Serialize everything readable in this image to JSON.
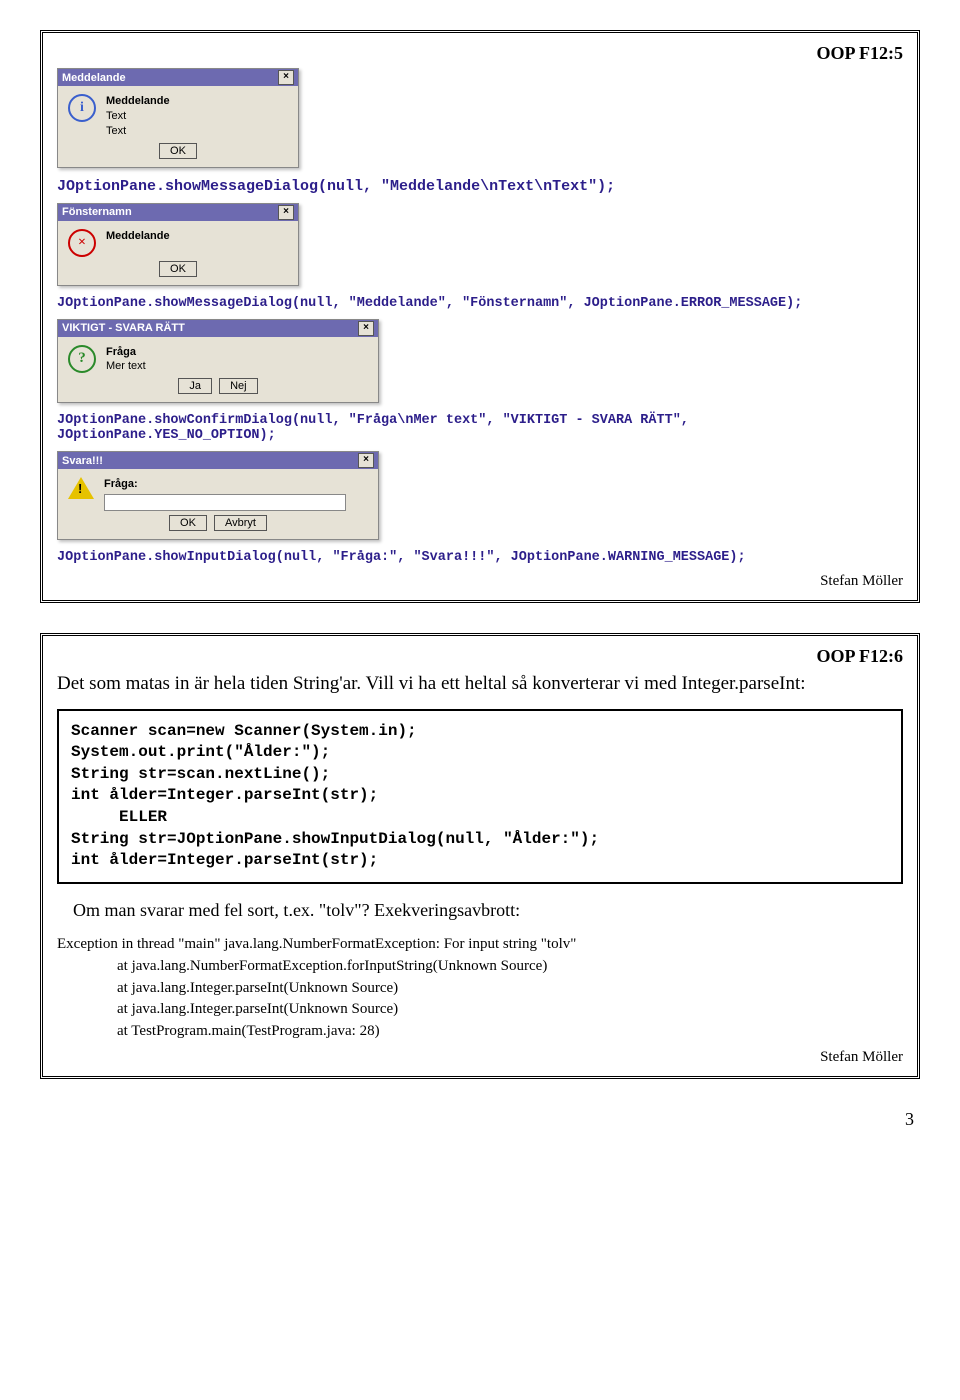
{
  "slide5": {
    "header": "OOP F12:5",
    "dialog1": {
      "title": "Meddelande",
      "lines": [
        "Meddelande",
        "Text",
        "Text"
      ],
      "ok": "OK"
    },
    "code1": "JOptionPane.showMessageDialog(null, \"Meddelande\\nText\\nText\");",
    "dialog2": {
      "title": "Fönsternamn",
      "line": "Meddelande",
      "ok": "OK"
    },
    "code2": "JOptionPane.showMessageDialog(null, \"Meddelande\", \"Fönsternamn\", JOptionPane.ERROR_MESSAGE);",
    "dialog3": {
      "title": "VIKTIGT - SVARA RÄTT",
      "lines": [
        "Fråga",
        "Mer text"
      ],
      "yes": "Ja",
      "no": "Nej"
    },
    "code3": "JOptionPane.showConfirmDialog(null, \"Fråga\\nMer text\", \"VIKTIGT - SVARA RÄTT\", JOptionPane.YES_NO_OPTION);",
    "dialog4": {
      "title": "Svara!!!",
      "label": "Fråga:",
      "ok": "OK",
      "cancel": "Avbryt"
    },
    "code4": "JOptionPane.showInputDialog(null, \"Fråga:\", \"Svara!!!\", JOptionPane.WARNING_MESSAGE);",
    "author": "Stefan Möller"
  },
  "slide6": {
    "header": "OOP F12:6",
    "intro": "Det som matas in är hela tiden String'ar. Vill vi ha ett heltal så konverterar vi med Integer.parseInt:",
    "codebox": "Scanner scan=new Scanner(System.in);\nSystem.out.print(\"Ålder:\");\nString str=scan.nextLine();\nint ålder=Integer.parseInt(str);\n     ELLER\nString str=JOptionPane.showInputDialog(null, \"Ålder:\");\nint ålder=Integer.parseInt(str);",
    "mid": "Om man svarar med fel sort, t.ex. \"tolv\"? Exekveringsavbrott:",
    "stack_head": "Exception in thread \"main\" java.lang.NumberFormatException: For input string \"tolv\"",
    "stack_lines": [
      "at java.lang.NumberFormatException.forInputString(Unknown Source)",
      "at java.lang.Integer.parseInt(Unknown Source)",
      "at java.lang.Integer.parseInt(Unknown Source)",
      "at TestProgram.main(TestProgram.java: 28)"
    ],
    "author": "Stefan Möller"
  },
  "page": "3"
}
